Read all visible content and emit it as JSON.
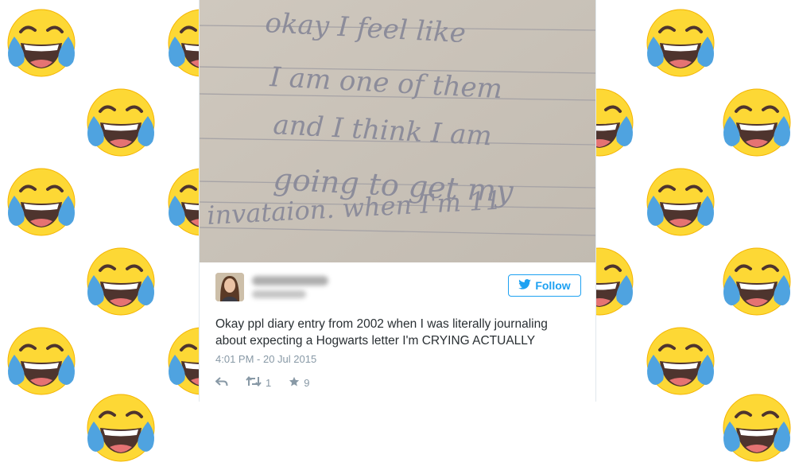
{
  "background": {
    "emoji": "face-with-tears-of-joy",
    "emoji_color": "#fdd835"
  },
  "tweet": {
    "photo": {
      "handwriting": [
        "okay I feel like",
        "I am one of them",
        "and I think I am",
        "going to get my",
        "invataion. when I'm 11"
      ]
    },
    "follow_label": "Follow",
    "text_lines": [
      "Okay ppl diary entry from 2002 when I was literally journaling",
      "about expecting a Hogwarts letter I'm CRYING ACTUALLY"
    ],
    "timestamp": "4:01 PM - 20 Jul 2015",
    "retweet_count": "1",
    "like_count": "9",
    "accent_color": "#1da1f2"
  }
}
